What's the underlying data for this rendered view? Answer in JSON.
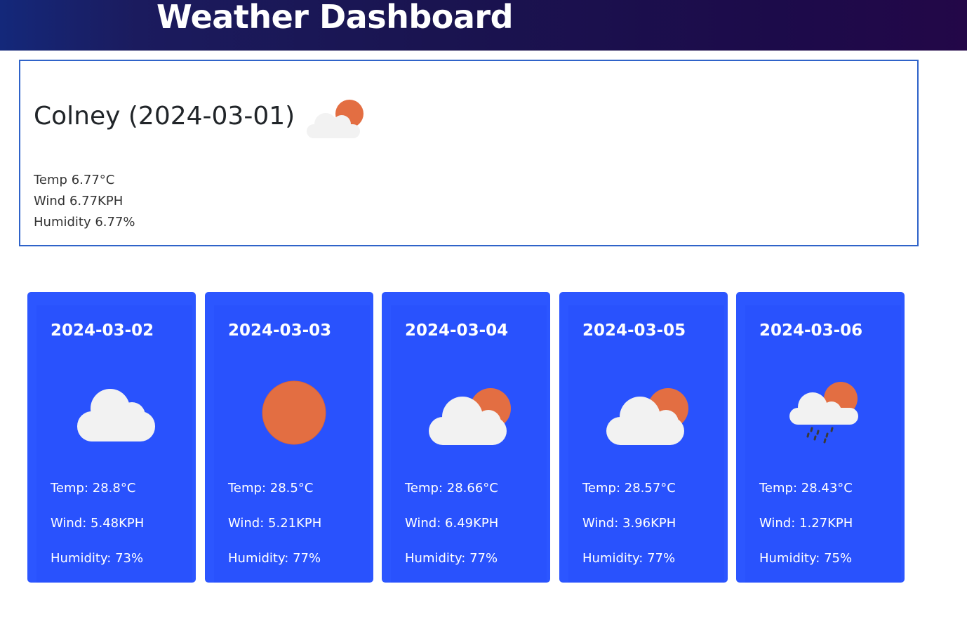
{
  "header": {
    "title": "Weather Dashboard"
  },
  "current": {
    "city_date": "Colney (2024-03-01)",
    "icon": "partly-cloudy-icon",
    "temp": "Temp 6.77°C",
    "wind": "Wind 6.77KPH",
    "humidity": "Humidity 6.77%"
  },
  "forecast": [
    {
      "date": "2024-03-02",
      "icon": "cloud-icon",
      "temp": "Temp: 28.8°C",
      "wind": "Wind: 5.48KPH",
      "humidity": "Humidity: 73%"
    },
    {
      "date": "2024-03-03",
      "icon": "sun-icon",
      "temp": "Temp: 28.5°C",
      "wind": "Wind: 5.21KPH",
      "humidity": "Humidity: 77%"
    },
    {
      "date": "2024-03-04",
      "icon": "partly-cloudy-icon",
      "temp": "Temp: 28.66°C",
      "wind": "Wind: 6.49KPH",
      "humidity": "Humidity: 77%"
    },
    {
      "date": "2024-03-05",
      "icon": "partly-cloudy-icon",
      "temp": "Temp: 28.57°C",
      "wind": "Wind: 3.96KPH",
      "humidity": "Humidity: 77%"
    },
    {
      "date": "2024-03-06",
      "icon": "rain-sun-icon",
      "temp": "Temp: 28.43°C",
      "wind": "Wind: 1.27KPH",
      "humidity": "Humidity: 75%"
    }
  ],
  "colors": {
    "card": "#2c56ff",
    "sun": "#e36e42",
    "cloud": "#f2f2f2",
    "border": "#2f63c9"
  }
}
